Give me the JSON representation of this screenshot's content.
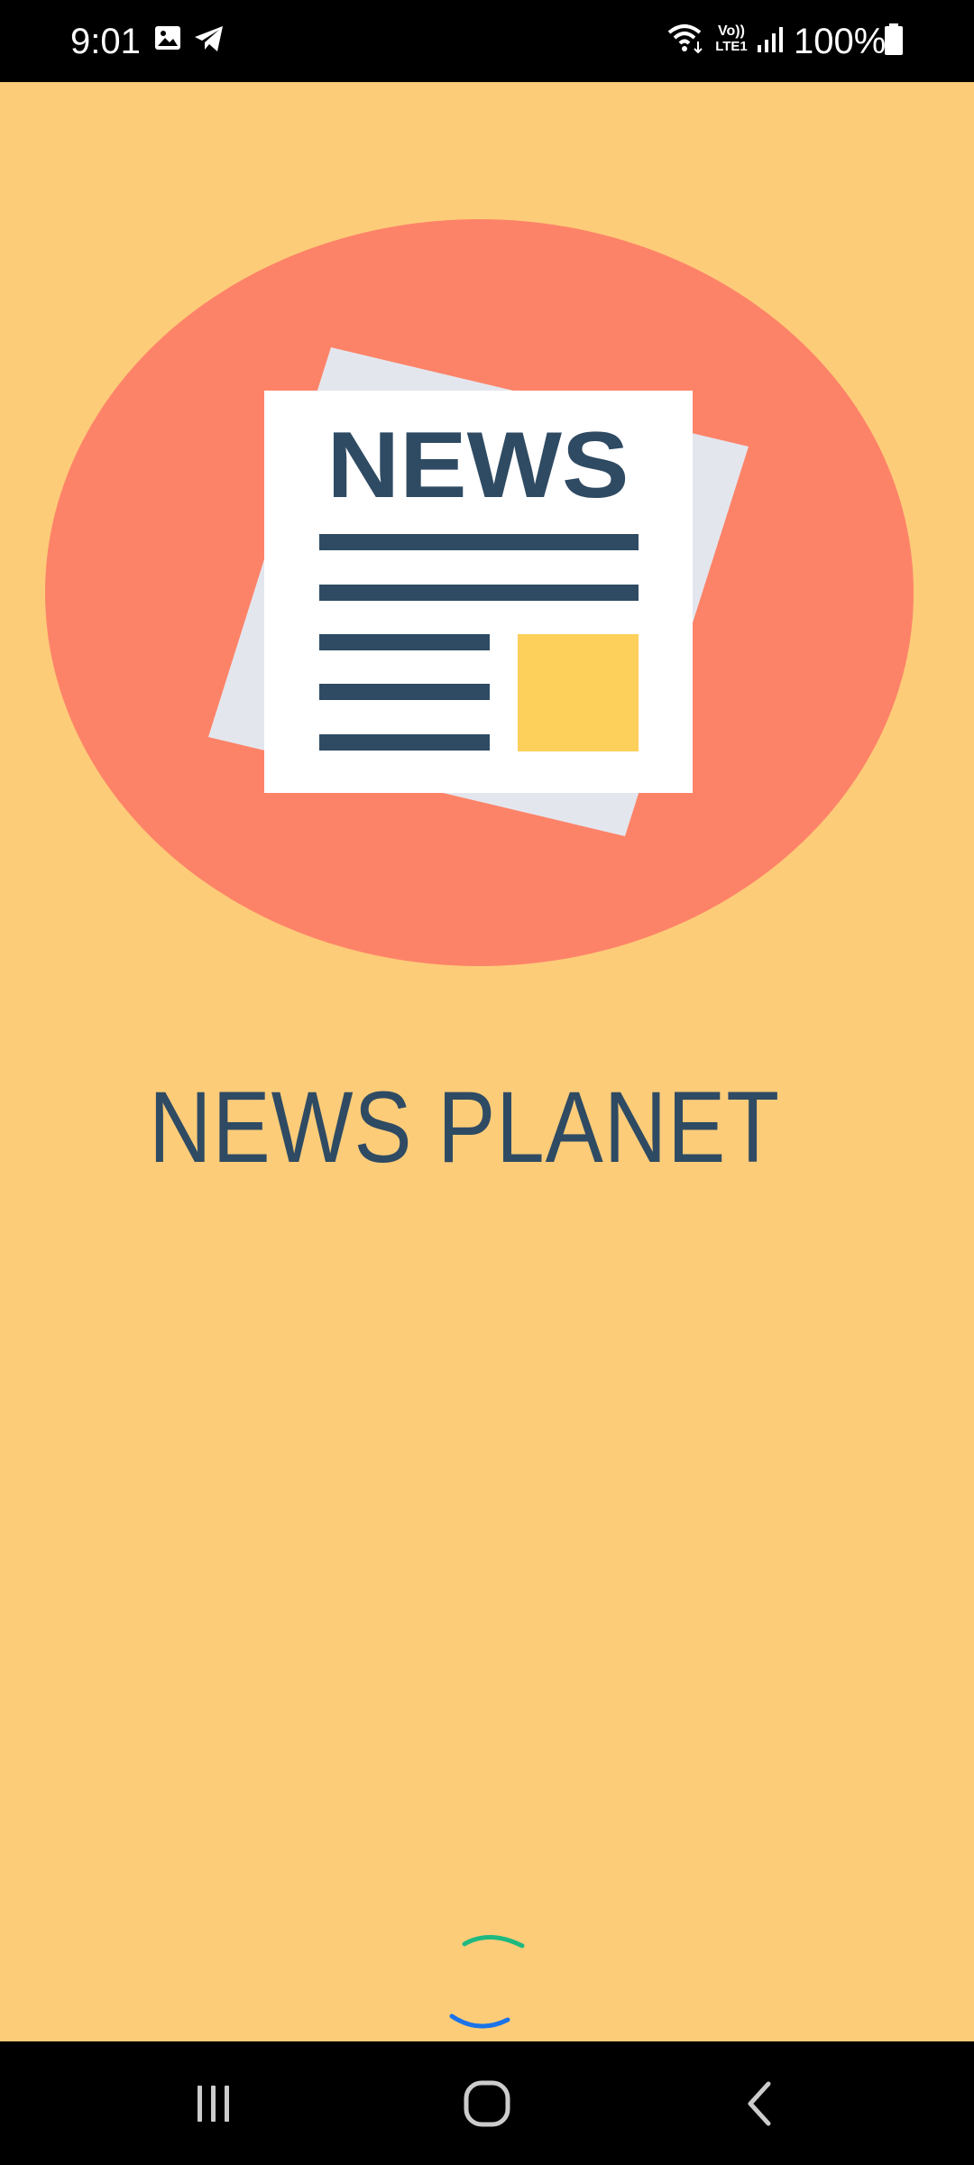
{
  "status_bar": {
    "time": "9:01",
    "battery_percent": "100%",
    "icons": [
      "gallery-icon",
      "telegram-icon",
      "wifi-icon",
      "volte-icon",
      "signal-icon",
      "battery-icon"
    ],
    "volte_label_top": "Vo))",
    "volte_label_bottom": "LTE1"
  },
  "logo": {
    "headline": "NEWS",
    "circle_color": "#fd8368",
    "paper_color": "#ffffff",
    "ink_color": "#2f4b63",
    "highlight_color": "#fdcf5b"
  },
  "app": {
    "title": "NEWS PLANET",
    "background_color": "#fdcc79"
  },
  "navigation": {
    "buttons": [
      "recent-apps",
      "home",
      "back"
    ]
  }
}
